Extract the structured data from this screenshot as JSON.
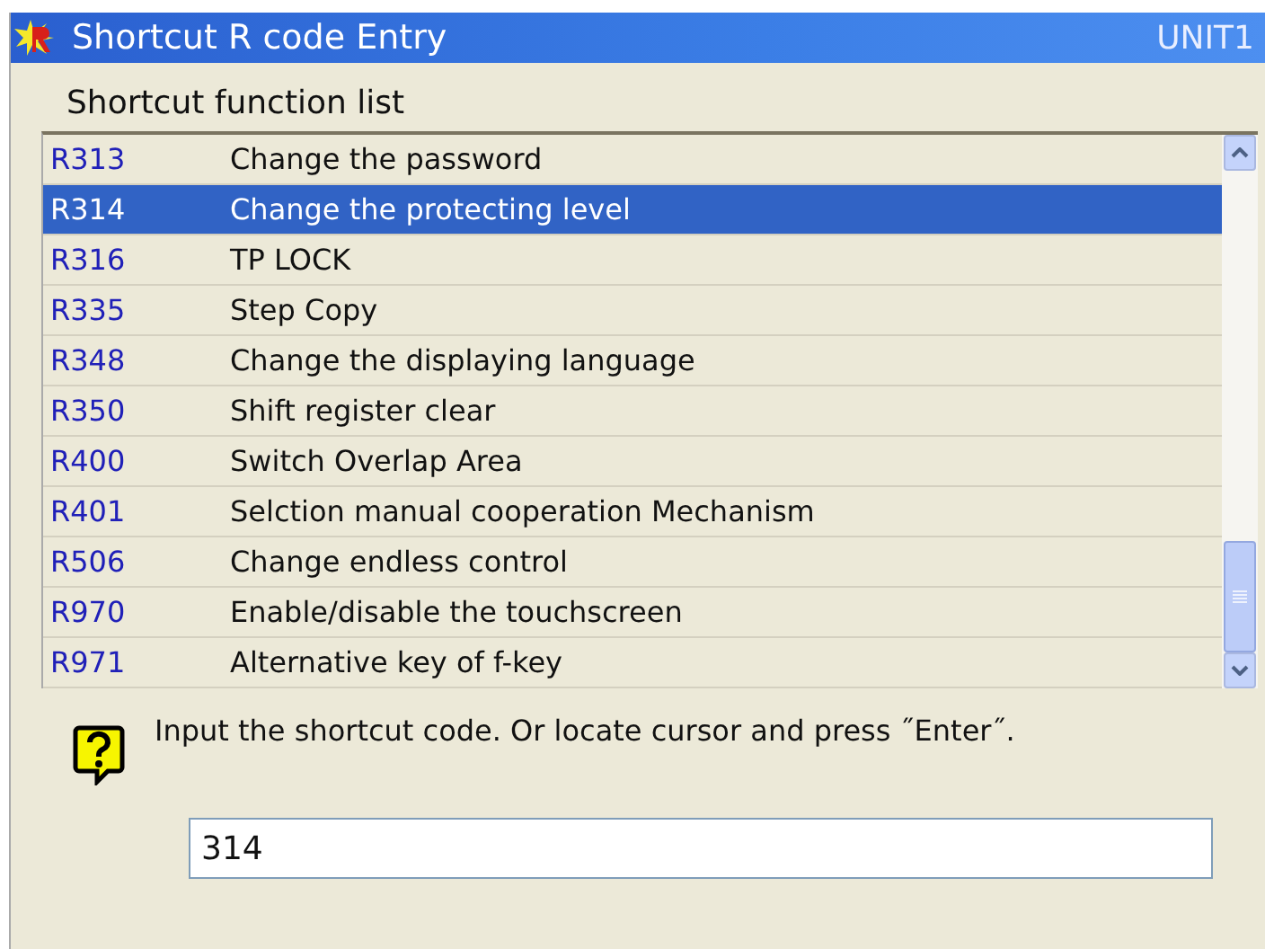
{
  "window": {
    "title": "Shortcut R code Entry",
    "unit": "UNIT1"
  },
  "list": {
    "label": "Shortcut function list",
    "rows": [
      {
        "code": "R313",
        "name": "Change the password",
        "selected": false
      },
      {
        "code": "R314",
        "name": "Change the protecting level",
        "selected": true
      },
      {
        "code": "R316",
        "name": "TP LOCK",
        "selected": false
      },
      {
        "code": "R335",
        "name": "Step Copy",
        "selected": false
      },
      {
        "code": "R348",
        "name": "Change the displaying language",
        "selected": false
      },
      {
        "code": "R350",
        "name": "Shift register clear",
        "selected": false
      },
      {
        "code": "R400",
        "name": "Switch Overlap Area",
        "selected": false
      },
      {
        "code": "R401",
        "name": "Selction manual cooperation Mechanism",
        "selected": false
      },
      {
        "code": "R506",
        "name": "Change endless control",
        "selected": false
      },
      {
        "code": "R970",
        "name": "Enable/disable the touchscreen",
        "selected": false
      },
      {
        "code": "R971",
        "name": "Alternative key of f-key",
        "selected": false
      }
    ]
  },
  "message": "Input the shortcut code. Or locate cursor and press ˝Enter˝.",
  "input": {
    "value": "314"
  }
}
